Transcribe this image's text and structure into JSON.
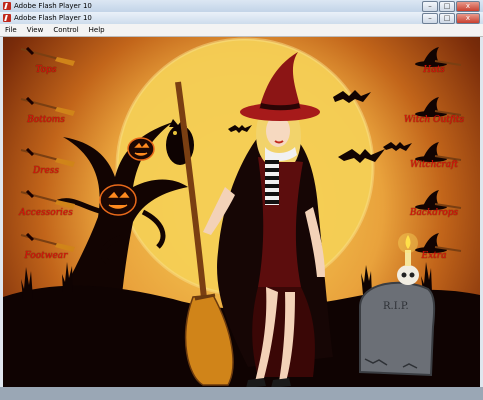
{
  "windows": {
    "back_title": "Adobe Flash Player 10",
    "front_title": "Adobe Flash Player 10",
    "buttons": {
      "minimize": "–",
      "maximize": "□",
      "close": "x"
    }
  },
  "menu": [
    "File",
    "View",
    "Control",
    "Help"
  ],
  "left_nav": [
    "Tops",
    "Bottoms",
    "Dress",
    "Accessories",
    "Footwear"
  ],
  "right_nav": [
    "Hats",
    "Witch Outfits",
    "Witchcraft",
    "Backdrops",
    "Extra"
  ],
  "gravestone_text": "R.I.P.",
  "colors": {
    "label": "#e0120b",
    "moon": "#f7d257",
    "silhouette": "#120402"
  }
}
